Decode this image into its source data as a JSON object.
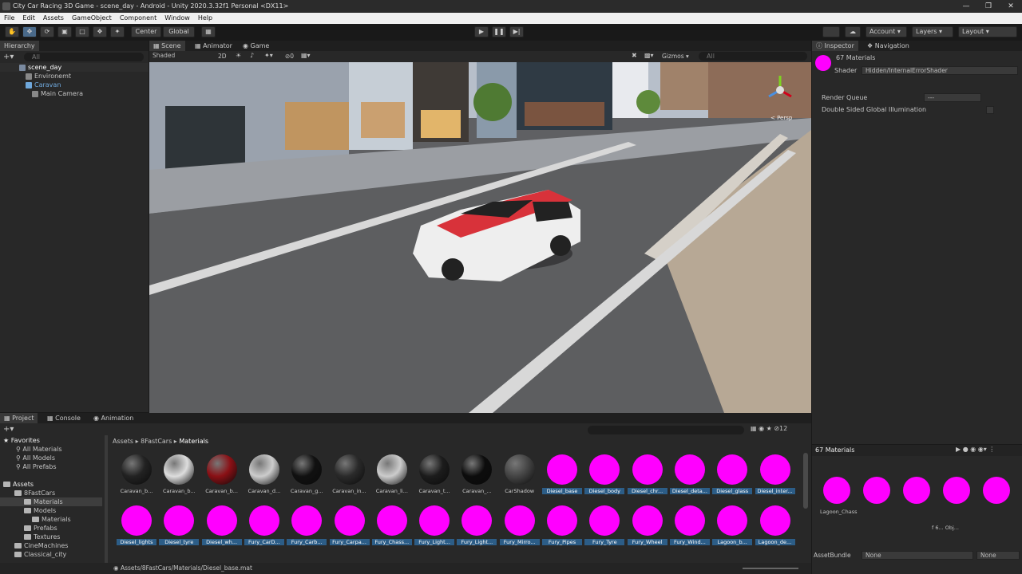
{
  "window": {
    "title": "City Car Racing 3D Game - scene_day - Android - Unity 2020.3.32f1 Personal <DX11>"
  },
  "menu": [
    "File",
    "Edit",
    "Assets",
    "GameObject",
    "Component",
    "Window",
    "Help"
  ],
  "toolbar": {
    "pivot": "Center",
    "space": "Global",
    "account": "Account",
    "layers": "Layers",
    "layout": "Layout"
  },
  "hierarchy": {
    "tab": "Hierarchy",
    "search": "All",
    "root": "scene_day",
    "items": [
      "Environemt",
      "Caravan",
      "Main Camera"
    ]
  },
  "scene": {
    "tabs": [
      "Scene",
      "Animator",
      "Game"
    ],
    "shading": "Shaded",
    "mode_2d": "2D",
    "fx_count": "0",
    "gizmos": "Gizmos",
    "search": "All",
    "persp": "< Persp"
  },
  "inspector": {
    "tabs": [
      "Inspector",
      "Navigation"
    ],
    "title": "67 Materials",
    "shader_label": "Shader",
    "shader_value": "Hidden/InternalErrorShader",
    "render_queue_label": "Render Queue",
    "render_queue_value": "---",
    "double_sided_label": "Double Sided Global Illumination"
  },
  "project": {
    "tabs": [
      "Project",
      "Console",
      "Animation"
    ],
    "favorites_label": "Favorites",
    "favorites": [
      "All Materials",
      "All Models",
      "All Prefabs"
    ],
    "assets_label": "Assets",
    "tree": [
      "8FastCars",
      "Materials",
      "Models",
      "Materials",
      "Prefabs",
      "Textures",
      "CineMachines",
      "Classical_city"
    ],
    "breadcrumb": [
      "Assets",
      "8FastCars",
      "Materials"
    ],
    "count": "12",
    "status_path": "Assets/8FastCars/Materials/Diesel_base.mat"
  },
  "materials_row1": [
    "Caravan_b...",
    "Caravan_b...",
    "Caravan_b...",
    "Caravan_d...",
    "Caravan_g...",
    "Caravan_in...",
    "Caravan_li...",
    "Caravan_t...",
    "Caravan_...",
    "CarShadow",
    "Diesel_base",
    "Diesel_body",
    "Diesel_chr...",
    "Diesel_deta...",
    "Diesel_glass",
    "Diesel_inter..."
  ],
  "materials_row2": [
    "Diesel_lights",
    "Diesel_tyre",
    "Diesel_wh...",
    "Fury_CarD...",
    "Fury_Carb...",
    "Fury_Carpa...",
    "Fury_Chass...",
    "Fury_Light...",
    "Fury_Light...",
    "Fury_Mirro...",
    "Fury_Pipes",
    "Fury_Tyre",
    "Fury_Wheel",
    "Fury_Wind...",
    "Lagoon_b...",
    "Lagoon_de..."
  ],
  "preview": {
    "title": "67 Materials",
    "label": "Lagoon_Chass",
    "page": "f 6... Obj...",
    "assetbundle_label": "AssetBundle",
    "assetbundle_value": "None",
    "assetbundle_variant": "None"
  },
  "colors": {
    "pink": "#ff00ff",
    "selection": "#2c5d87"
  }
}
